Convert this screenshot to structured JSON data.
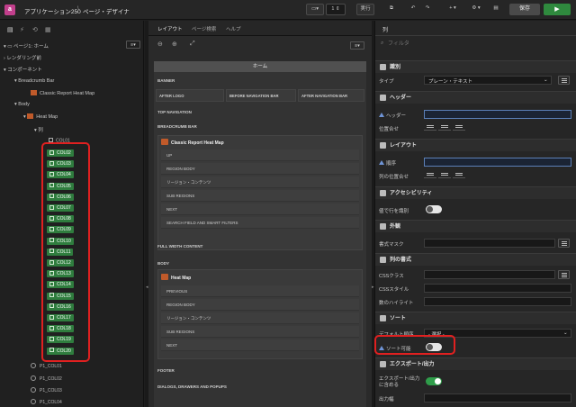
{
  "topbar": {
    "app_icon_letter": "a",
    "app_name": "アプリケーション250",
    "separator": "\\",
    "page_name": "ページ・デザイナ",
    "page_number": "1",
    "run_label": "実行",
    "save_label": "保存"
  },
  "left": {
    "page_item": "ページ1: ホーム",
    "rendering": "レンダリング前",
    "components": "コンポーネント",
    "breadcrumb_bar": "Breadcrumb Bar",
    "classic_report": "Classic Report Heat Map",
    "body": "Body",
    "heat_map": "Heat Map",
    "columns_label": "列",
    "col01": "COL01",
    "highlighted_columns": [
      "COL02",
      "COL03",
      "COL04",
      "COL05",
      "COL06",
      "COL07",
      "COL08",
      "COL09",
      "COL10",
      "COL11",
      "COL12",
      "COL13",
      "COL14",
      "COL15",
      "COL16",
      "COL17",
      "COL18",
      "COL19",
      "COL20"
    ],
    "hidden_items": [
      "P1_COL01",
      "P1_COL02",
      "P1_COL03",
      "P1_COL04"
    ]
  },
  "mid": {
    "tabs": [
      "レイアウト",
      "ページ検索",
      "ヘルプ"
    ],
    "home": "ホーム",
    "banner": "BANNER",
    "after_logo": "AFTER LOGO",
    "before_nav": "BEFORE NAVIGATION BAR",
    "after_nav": "AFTER NAVIGATION BAR",
    "top_nav": "TOP NAVIGATION",
    "breadcrumb_bar": "BREADCRUMB BAR",
    "classic_report": "Classic Report Heat Map",
    "cr_rows": [
      "UP",
      "REGION BODY",
      "リージョン・コンテンツ",
      "SUB REGIONS",
      "NEXT",
      "SEARCH FIELD AND SMART FILTERS"
    ],
    "full_width": "FULL WIDTH CONTENT",
    "body": "BODY",
    "heat_map": "Heat Map",
    "hm_rows": [
      "PREVIOUS",
      "REGION BODY",
      "リージョン・コンテンツ",
      "SUB REGIONS",
      "NEXT"
    ],
    "footer": "FOOTER",
    "dialogs": "DIALOGS, DRAWERS AND POPUPS"
  },
  "right": {
    "title": "列",
    "filter_placeholder": "フィルタ",
    "sections": {
      "identification": "識別",
      "type_label": "タイプ",
      "type_value": "プレーン・テキスト",
      "heading": "ヘッダー",
      "heading_label": "ヘッダー",
      "alignment_label": "位置合せ",
      "layout": "レイアウト",
      "sequence_label": "順序",
      "col_alignment_label": "列の位置合せ",
      "accessibility": "アクセシビリティ",
      "row_header_label": "値で行を識別",
      "appearance": "外観",
      "format_mask_label": "書式マスク",
      "column_format": "列の書式",
      "css_class_label": "CSSクラス",
      "css_style_label": "CSSスタイル",
      "highlight_label": "数のハイライト",
      "sort": "ソート",
      "default_sort_label": "デフォルト順序",
      "default_sort_value": "- 選択 -",
      "sortable_label": "ソート可能",
      "export": "エクスポート/出力",
      "export_label": "エクスポート/出力に含める",
      "output_width_label": "出力幅"
    }
  }
}
